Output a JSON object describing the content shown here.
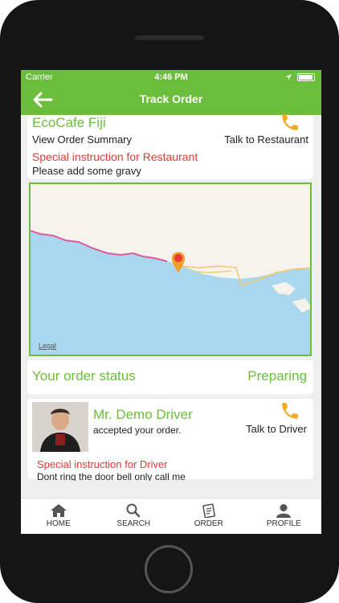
{
  "status_bar": {
    "carrier": "Carrier",
    "time": "4:46 PM"
  },
  "nav": {
    "title": "Track Order",
    "back_icon": "back-arrow-icon"
  },
  "restaurant": {
    "name": "EcoCafe Fiji",
    "view_summary": "View Order Summary",
    "talk_label": "Talk to Restaurant",
    "special_label": "Special instruction for Restaurant",
    "special_text": "Please add some gravy"
  },
  "map": {
    "legal": "Legal"
  },
  "order_status": {
    "label": "Your order status",
    "value": "Preparing"
  },
  "driver": {
    "name": "Mr. Demo Driver",
    "accepted": "accepted your order.",
    "talk_label": "Talk to Driver",
    "special_label": "Special instruction for Driver",
    "special_text": "Dont ring the door bell only call me"
  },
  "tabs": [
    {
      "label": "HOME",
      "icon": "home-icon"
    },
    {
      "label": "SEARCH",
      "icon": "search-icon"
    },
    {
      "label": "ORDER",
      "icon": "order-icon"
    },
    {
      "label": "PROFILE",
      "icon": "profile-icon"
    }
  ],
  "colors": {
    "accent": "#6bbd3c",
    "alert": "#e53935",
    "phone_icon": "#f5a623"
  }
}
